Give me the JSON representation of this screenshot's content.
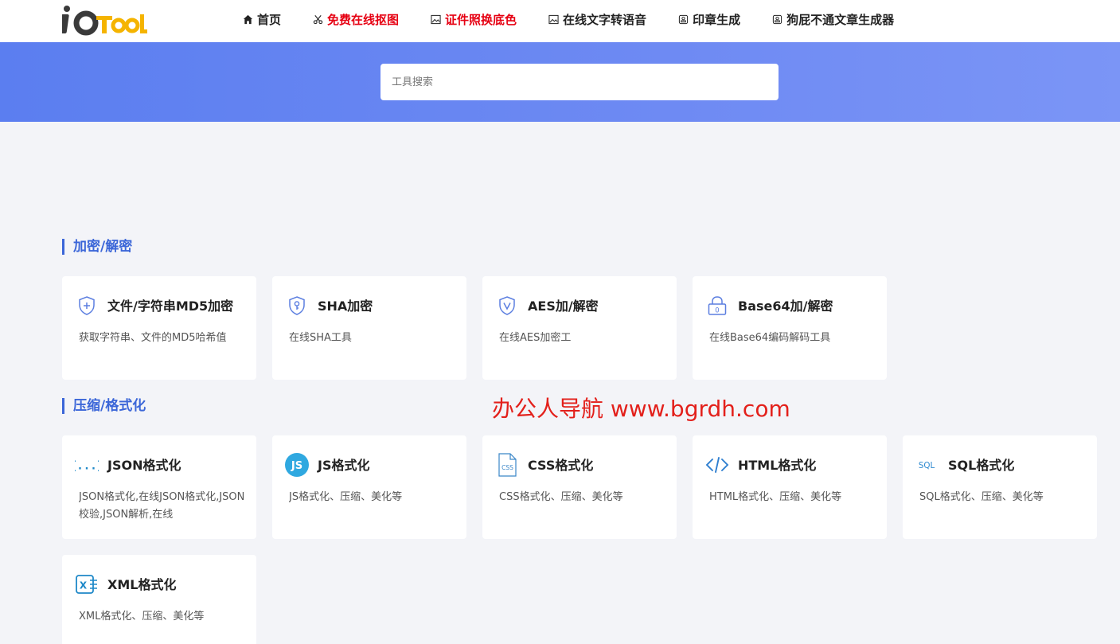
{
  "logo": {
    "text": "ioTool"
  },
  "nav": [
    {
      "label": "首页",
      "icon": "home-icon",
      "color": "#222222"
    },
    {
      "label": "免费在线抠图",
      "icon": "scissors-icon",
      "color": "#e60012"
    },
    {
      "label": "证件照换底色",
      "icon": "image-icon",
      "color": "#e60012"
    },
    {
      "label": "在线文字转语音",
      "icon": "image-icon",
      "color": "#222222"
    },
    {
      "label": "印章生成",
      "icon": "stamp-icon",
      "color": "#222222"
    },
    {
      "label": "狗屁不通文章生成器",
      "icon": "stamp-icon",
      "color": "#222222"
    }
  ],
  "search": {
    "placeholder": "工具搜索"
  },
  "sections": [
    {
      "title": "加密/解密",
      "cards": [
        {
          "title": "文件/字符串MD5加密",
          "desc": "获取字符串、文件的MD5哈希值",
          "icon": "shield-plus-icon"
        },
        {
          "title": "SHA加密",
          "desc": "在线SHA工具",
          "icon": "shield-key-icon"
        },
        {
          "title": "AES加/解密",
          "desc": "在线AES加密工",
          "icon": "shield-check-icon"
        },
        {
          "title": "Base64加/解密",
          "desc": "在线Base64编码解码工具",
          "icon": "lock-icon"
        }
      ]
    },
    {
      "title": "压缩/格式化",
      "cards": [
        {
          "title": "JSON格式化",
          "desc": "JSON格式化,在线JSON格式化,JSON校验,JSON解析,在线",
          "icon": "json-icon",
          "icon_text": "{...}"
        },
        {
          "title": "JS格式化",
          "desc": "JS格式化、压缩、美化等",
          "icon": "js-icon",
          "icon_text": "JS"
        },
        {
          "title": "CSS格式化",
          "desc": "CSS格式化、压缩、美化等",
          "icon": "css-file-icon",
          "icon_text": "CSS"
        },
        {
          "title": "HTML格式化",
          "desc": "HTML格式化、压缩、美化等",
          "icon": "code-icon"
        },
        {
          "title": "SQL格式化",
          "desc": "SQL格式化、压缩、美化等",
          "icon": "sql-icon",
          "icon_text": "SQL"
        },
        {
          "title": "XML格式化",
          "desc": "XML格式化、压缩、美化等",
          "icon": "xml-icon",
          "icon_text": "X"
        }
      ]
    }
  ],
  "watermark": "办公人导航 www.bgrdh.com",
  "colors": {
    "accent": "#3b66d8",
    "hero_start": "#5b7ef0",
    "hero_end": "#7b95f6",
    "nav_red": "#e60012",
    "watermark": "#e3201b"
  }
}
